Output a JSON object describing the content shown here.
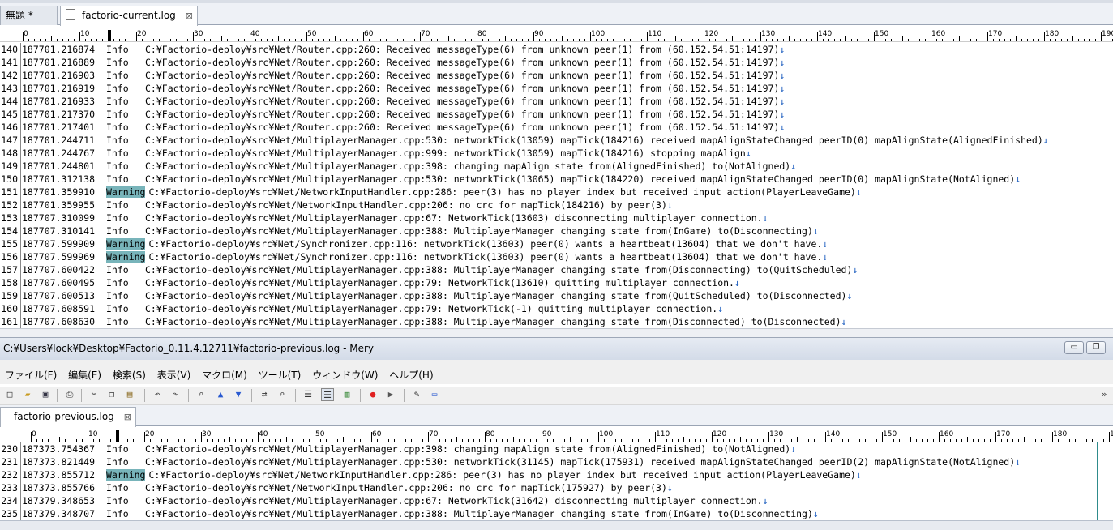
{
  "top_pane": {
    "tabs": [
      {
        "label": "無題 *",
        "close": ""
      },
      {
        "label": "factorio-current.log",
        "close": "⊠"
      }
    ],
    "ruler_labels": [
      "0",
      "10",
      "20",
      "30",
      "40",
      "50",
      "60",
      "70",
      "80",
      "90",
      "100",
      "110",
      "120",
      "130",
      "140",
      "150",
      "160",
      "170",
      "180",
      "190"
    ],
    "lines": [
      {
        "num": "140",
        "ts": "187701.216874",
        "lvl": "Info",
        "msg": "C:¥Factorio-deploy¥src¥Net/Router.cpp:260: Received messageType(6) from unknown peer(1) from (60.152.54.51:14197)"
      },
      {
        "num": "141",
        "ts": "187701.216889",
        "lvl": "Info",
        "msg": "C:¥Factorio-deploy¥src¥Net/Router.cpp:260: Received messageType(6) from unknown peer(1) from (60.152.54.51:14197)"
      },
      {
        "num": "142",
        "ts": "187701.216903",
        "lvl": "Info",
        "msg": "C:¥Factorio-deploy¥src¥Net/Router.cpp:260: Received messageType(6) from unknown peer(1) from (60.152.54.51:14197)"
      },
      {
        "num": "143",
        "ts": "187701.216919",
        "lvl": "Info",
        "msg": "C:¥Factorio-deploy¥src¥Net/Router.cpp:260: Received messageType(6) from unknown peer(1) from (60.152.54.51:14197)"
      },
      {
        "num": "144",
        "ts": "187701.216933",
        "lvl": "Info",
        "msg": "C:¥Factorio-deploy¥src¥Net/Router.cpp:260: Received messageType(6) from unknown peer(1) from (60.152.54.51:14197)"
      },
      {
        "num": "145",
        "ts": "187701.217370",
        "lvl": "Info",
        "msg": "C:¥Factorio-deploy¥src¥Net/Router.cpp:260: Received messageType(6) from unknown peer(1) from (60.152.54.51:14197)"
      },
      {
        "num": "146",
        "ts": "187701.217401",
        "lvl": "Info",
        "msg": "C:¥Factorio-deploy¥src¥Net/Router.cpp:260: Received messageType(6) from unknown peer(1) from (60.152.54.51:14197)"
      },
      {
        "num": "147",
        "ts": "187701.244711",
        "lvl": "Info",
        "msg": "C:¥Factorio-deploy¥src¥Net/MultiplayerManager.cpp:530: networkTick(13059) mapTick(184216) received mapAlignStateChanged peerID(0) mapAlignState(AlignedFinished)"
      },
      {
        "num": "148",
        "ts": "187701.244767",
        "lvl": "Info",
        "msg": "C:¥Factorio-deploy¥src¥Net/MultiplayerManager.cpp:999: networkTick(13059) mapTick(184216) stopping mapAlign"
      },
      {
        "num": "149",
        "ts": "187701.244801",
        "lvl": "Info",
        "msg": "C:¥Factorio-deploy¥src¥Net/MultiplayerManager.cpp:398: changing mapAlign state from(AlignedFinished) to(NotAligned)"
      },
      {
        "num": "150",
        "ts": "187701.312138",
        "lvl": "Info",
        "msg": "C:¥Factorio-deploy¥src¥Net/MultiplayerManager.cpp:530: networkTick(13065) mapTick(184220) received mapAlignStateChanged peerID(0) mapAlignState(NotAligned)"
      },
      {
        "num": "151",
        "ts": "187701.359910",
        "lvl": "Warning",
        "msg": "C:¥Factorio-deploy¥src¥Net/NetworkInputHandler.cpp:286: peer(3) has no player index but received input action(PlayerLeaveGame)"
      },
      {
        "num": "152",
        "ts": "187701.359955",
        "lvl": "Info",
        "msg": "C:¥Factorio-deploy¥src¥Net/NetworkInputHandler.cpp:206: no crc for mapTick(184216) by peer(3)"
      },
      {
        "num": "153",
        "ts": "187707.310099",
        "lvl": "Info",
        "msg": "C:¥Factorio-deploy¥src¥Net/MultiplayerManager.cpp:67: NetworkTick(13603) disconnecting multiplayer connection."
      },
      {
        "num": "154",
        "ts": "187707.310141",
        "lvl": "Info",
        "msg": "C:¥Factorio-deploy¥src¥Net/MultiplayerManager.cpp:388: MultiplayerManager changing state from(InGame) to(Disconnecting)"
      },
      {
        "num": "155",
        "ts": "187707.599909",
        "lvl": "Warning",
        "msg": "C:¥Factorio-deploy¥src¥Net/Synchronizer.cpp:116: networkTick(13603) peer(0) wants a heartbeat(13604) that we don't have."
      },
      {
        "num": "156",
        "ts": "187707.599969",
        "lvl": "Warning",
        "msg": "C:¥Factorio-deploy¥src¥Net/Synchronizer.cpp:116: networkTick(13603) peer(0) wants a heartbeat(13604) that we don't have."
      },
      {
        "num": "157",
        "ts": "187707.600422",
        "lvl": "Info",
        "msg": "C:¥Factorio-deploy¥src¥Net/MultiplayerManager.cpp:388: MultiplayerManager changing state from(Disconnecting) to(QuitScheduled)"
      },
      {
        "num": "158",
        "ts": "187707.600495",
        "lvl": "Info",
        "msg": "C:¥Factorio-deploy¥src¥Net/MultiplayerManager.cpp:79: NetworkTick(13610) quitting multiplayer connection."
      },
      {
        "num": "159",
        "ts": "187707.600513",
        "lvl": "Info",
        "msg": "C:¥Factorio-deploy¥src¥Net/MultiplayerManager.cpp:388: MultiplayerManager changing state from(QuitScheduled) to(Disconnected)"
      },
      {
        "num": "160",
        "ts": "187707.608591",
        "lvl": "Info",
        "msg": "C:¥Factorio-deploy¥src¥Net/MultiplayerManager.cpp:79: NetworkTick(-1) quitting multiplayer connection."
      },
      {
        "num": "161",
        "ts": "187707.608630",
        "lvl": "Info",
        "msg": "C:¥Factorio-deploy¥src¥Net/MultiplayerManager.cpp:388: MultiplayerManager changing state from(Disconnected) to(Disconnected)"
      }
    ]
  },
  "window": {
    "title": "C:¥Users¥lock¥Desktop¥Factorio_0.11.4.12711¥factorio-previous.log - Mery",
    "minimize": "▭",
    "restore": "❐"
  },
  "menu": [
    "ファイル(F)",
    "編集(E)",
    "検索(S)",
    "表示(V)",
    "マクロ(M)",
    "ツール(T)",
    "ウィンドウ(W)",
    "ヘルプ(H)"
  ],
  "toolbar_icons": [
    "new-icon",
    "open-icon",
    "save-icon",
    "print-icon",
    "cut-icon",
    "copy-icon",
    "paste-icon",
    "undo-icon",
    "redo-icon",
    "find-icon",
    "find-prev-icon",
    "find-next-icon",
    "replace-icon",
    "grep-icon",
    "wrap-none-icon",
    "wrap-window-icon",
    "wrap-column-icon",
    "record-icon",
    "play-icon",
    "pin-icon",
    "panel-icon"
  ],
  "bottom_pane": {
    "tab": {
      "label": "factorio-previous.log",
      "close": "⊠"
    },
    "ruler_labels": [
      "0",
      "10",
      "20",
      "30",
      "40",
      "50",
      "60",
      "70",
      "80",
      "90",
      "100",
      "110",
      "120",
      "130",
      "140",
      "150",
      "160",
      "170",
      "180",
      "190"
    ],
    "lines": [
      {
        "num": "230",
        "ts": "187373.754367",
        "lvl": "Info",
        "msg": "C:¥Factorio-deploy¥src¥Net/MultiplayerManager.cpp:398: changing mapAlign state from(AlignedFinished) to(NotAligned)"
      },
      {
        "num": "231",
        "ts": "187373.821449",
        "lvl": "Info",
        "msg": "C:¥Factorio-deploy¥src¥Net/MultiplayerManager.cpp:530: networkTick(31145) mapTick(175931) received mapAlignStateChanged peerID(2) mapAlignState(NotAligned)"
      },
      {
        "num": "232",
        "ts": "187373.855712",
        "lvl": "Warning",
        "msg": "C:¥Factorio-deploy¥src¥Net/NetworkInputHandler.cpp:286: peer(3) has no player index but received input action(PlayerLeaveGame)"
      },
      {
        "num": "233",
        "ts": "187373.855766",
        "lvl": "Info",
        "msg": "C:¥Factorio-deploy¥src¥Net/NetworkInputHandler.cpp:206: no crc for mapTick(175927) by peer(3)"
      },
      {
        "num": "234",
        "ts": "187379.348653",
        "lvl": "Info",
        "msg": "C:¥Factorio-deploy¥src¥Net/MultiplayerManager.cpp:67: NetworkTick(31642) disconnecting multiplayer connection."
      },
      {
        "num": "235",
        "ts": "187379.348707",
        "lvl": "Info",
        "msg": "C:¥Factorio-deploy¥src¥Net/MultiplayerManager.cpp:388: MultiplayerManager changing state from(InGame) to(Disconnecting)"
      }
    ]
  },
  "eol_mark": "↓"
}
